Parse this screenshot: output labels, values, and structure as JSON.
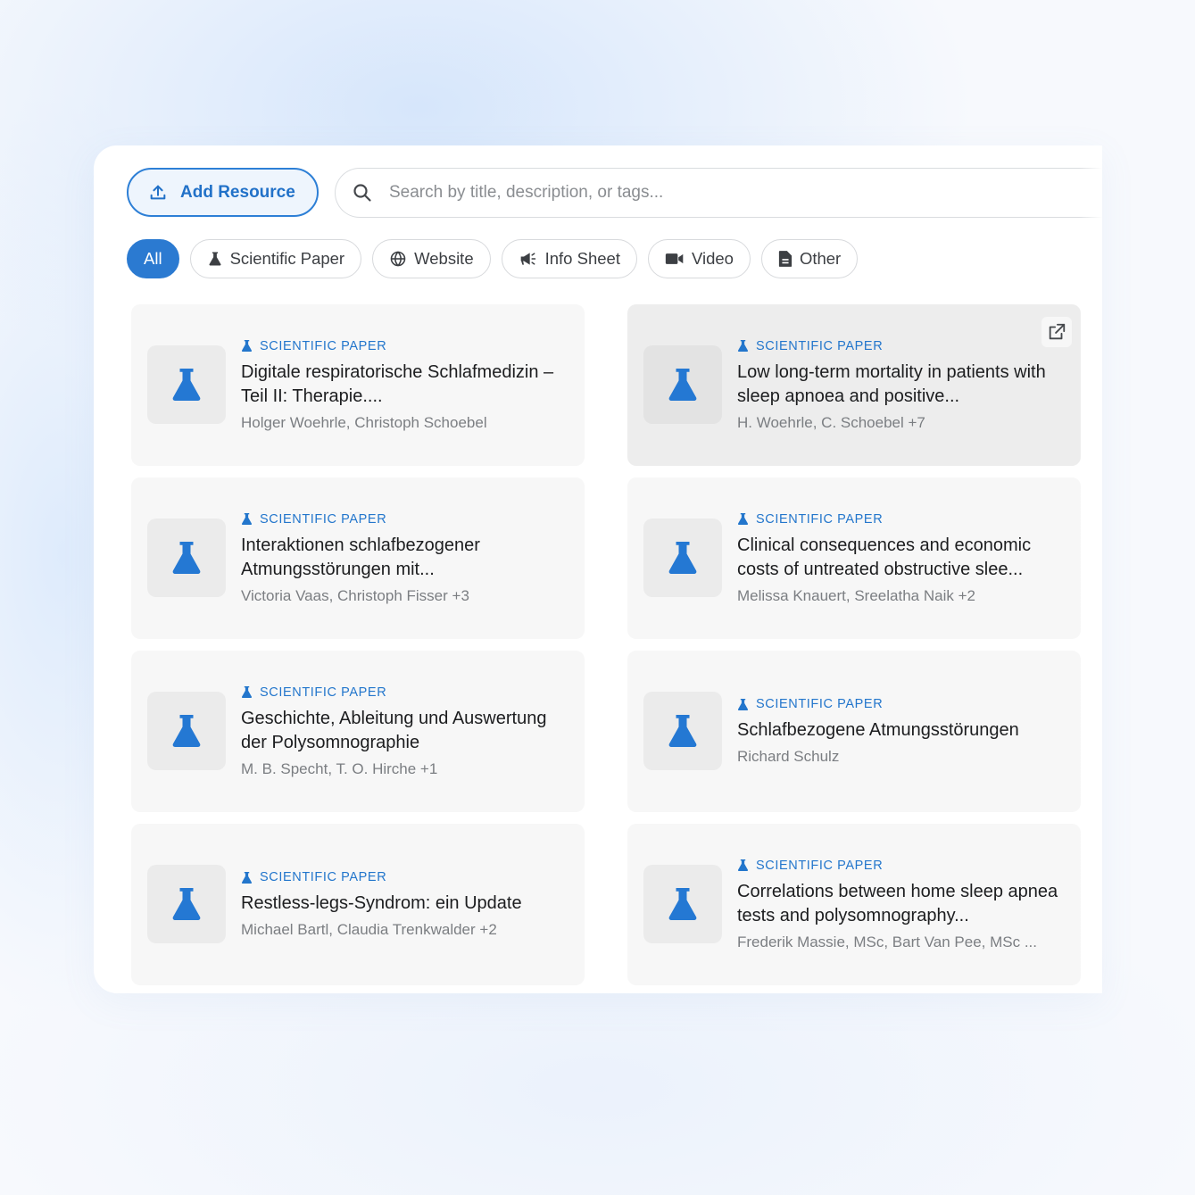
{
  "toolbar": {
    "add_label": "Add Resource",
    "search_placeholder": "Search by title, description, or tags..."
  },
  "filters": [
    {
      "label": "All",
      "icon": "none",
      "active": true
    },
    {
      "label": "Scientific Paper",
      "icon": "flask-icon"
    },
    {
      "label": "Website",
      "icon": "globe-icon"
    },
    {
      "label": "Info Sheet",
      "icon": "megaphone-icon"
    },
    {
      "label": "Video",
      "icon": "video-camera-icon"
    },
    {
      "label": "Other",
      "icon": "document-icon"
    }
  ],
  "colors": {
    "accent": "#2b7ad1",
    "card_bg": "#f7f7f7",
    "hover_card_bg": "#ededed"
  },
  "resources": [
    {
      "type": "SCIENTIFIC PAPER",
      "title": "Digitale respiratorische Schlafmedizin – Teil II: Therapie....",
      "authors": "Holger Woehrle, Christoph Schoebel"
    },
    {
      "type": "SCIENTIFIC PAPER",
      "title": "Low long-term mortality in patients with sleep apnoea and positive...",
      "authors": "H. Woehrle, C. Schoebel +7",
      "hovered": true
    },
    {
      "type": "SCIENTIFIC PAPER",
      "title": "Interaktionen schlafbezogener Atmungsstörungen mit...",
      "authors": "Victoria Vaas, Christoph Fisser +3"
    },
    {
      "type": "SCIENTIFIC PAPER",
      "title": "Clinical consequences and economic costs of untreated obstructive slee...",
      "authors": "Melissa Knauert, Sreelatha Naik +2"
    },
    {
      "type": "SCIENTIFIC PAPER",
      "title": "Geschichte, Ableitung und Auswertung der Polysomnographie",
      "authors": "M. B. Specht, T. O. Hirche +1"
    },
    {
      "type": "SCIENTIFIC PAPER",
      "title": "Schlafbezogene Atmungsstörungen",
      "authors": "Richard Schulz"
    },
    {
      "type": "SCIENTIFIC PAPER",
      "title": "Restless-legs-Syndrom: ein Update",
      "authors": "Michael Bartl, Claudia Trenkwalder +2"
    },
    {
      "type": "SCIENTIFIC PAPER",
      "title": "Correlations between home sleep apnea tests and polysomnography...",
      "authors": "Frederik Massie, MSc, Bart Van Pee, MSc ..."
    }
  ]
}
